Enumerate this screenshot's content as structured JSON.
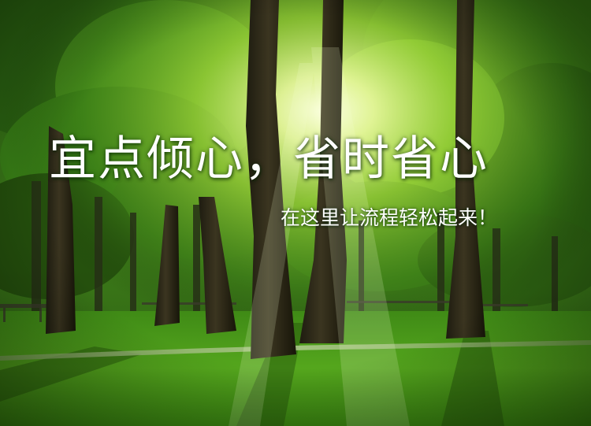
{
  "banner": {
    "headline": "宜点倾心，省时省心",
    "subline": "在这里让流程轻松起来！"
  },
  "scene": {
    "icon": "forest-park-photo",
    "colors": {
      "sunlight": "#f4ffc8",
      "canopy_light": "#8ccf2e",
      "canopy_dark": "#1f4a0d",
      "lawn": "#4c9a18",
      "trunk": "#2a2516"
    }
  }
}
